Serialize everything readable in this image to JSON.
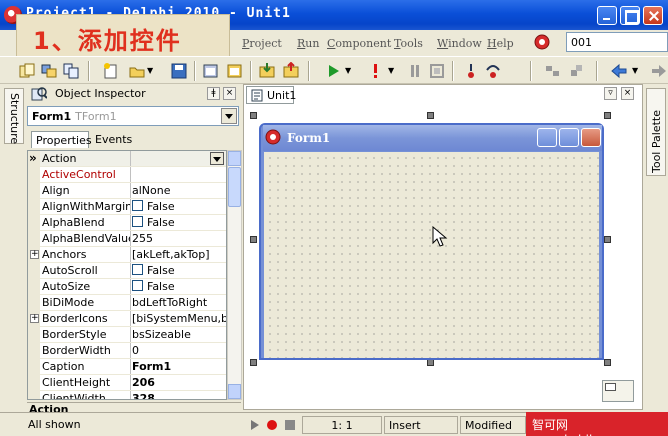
{
  "window": {
    "title": "Project1 - Delphi 2010 - Unit1"
  },
  "overlay": {
    "text": "1、添加控件"
  },
  "menu": {
    "items": [
      "Project",
      "Run",
      "Component",
      "Tools",
      "Window",
      "Help"
    ],
    "combo_value": "001"
  },
  "side_tabs": {
    "left": "Structure",
    "right": "Tool Palette"
  },
  "object_inspector": {
    "title": "Object Inspector",
    "object_name": "Form1",
    "object_class": "TForm1",
    "tabs": [
      "Properties",
      "Events"
    ],
    "properties": [
      {
        "name": "Action",
        "value": ""
      },
      {
        "name": "ActiveControl",
        "value": ""
      },
      {
        "name": "Align",
        "value": "alNone"
      },
      {
        "name": "AlignWithMargins",
        "value": "False"
      },
      {
        "name": "AlphaBlend",
        "value": "False"
      },
      {
        "name": "AlphaBlendValue",
        "value": "255"
      },
      {
        "name": "Anchors",
        "value": "[akLeft,akTop]"
      },
      {
        "name": "AutoScroll",
        "value": "False"
      },
      {
        "name": "AutoSize",
        "value": "False"
      },
      {
        "name": "BiDiMode",
        "value": "bdLeftToRight"
      },
      {
        "name": "BorderIcons",
        "value": "[biSystemMenu,biMi"
      },
      {
        "name": "BorderStyle",
        "value": "bsSizeable"
      },
      {
        "name": "BorderWidth",
        "value": "0"
      },
      {
        "name": "Caption",
        "value": "Form1"
      },
      {
        "name": "ClientHeight",
        "value": "206"
      },
      {
        "name": "ClientWidth",
        "value": "328"
      }
    ],
    "hint": "Action",
    "filter": "All shown"
  },
  "designer": {
    "tab_label": "Unit1",
    "form_caption": "Form1"
  },
  "status": {
    "position": "1:   1",
    "mode": "Insert",
    "state": "Modified"
  },
  "watermark": {
    "text": "智可网 www.hzhike.com"
  },
  "colors": {
    "titlebar": "#0a4fd8",
    "overlay_text": "#e0301e",
    "form_frame": "#7590d6",
    "watermark_bg": "#d9232a"
  }
}
